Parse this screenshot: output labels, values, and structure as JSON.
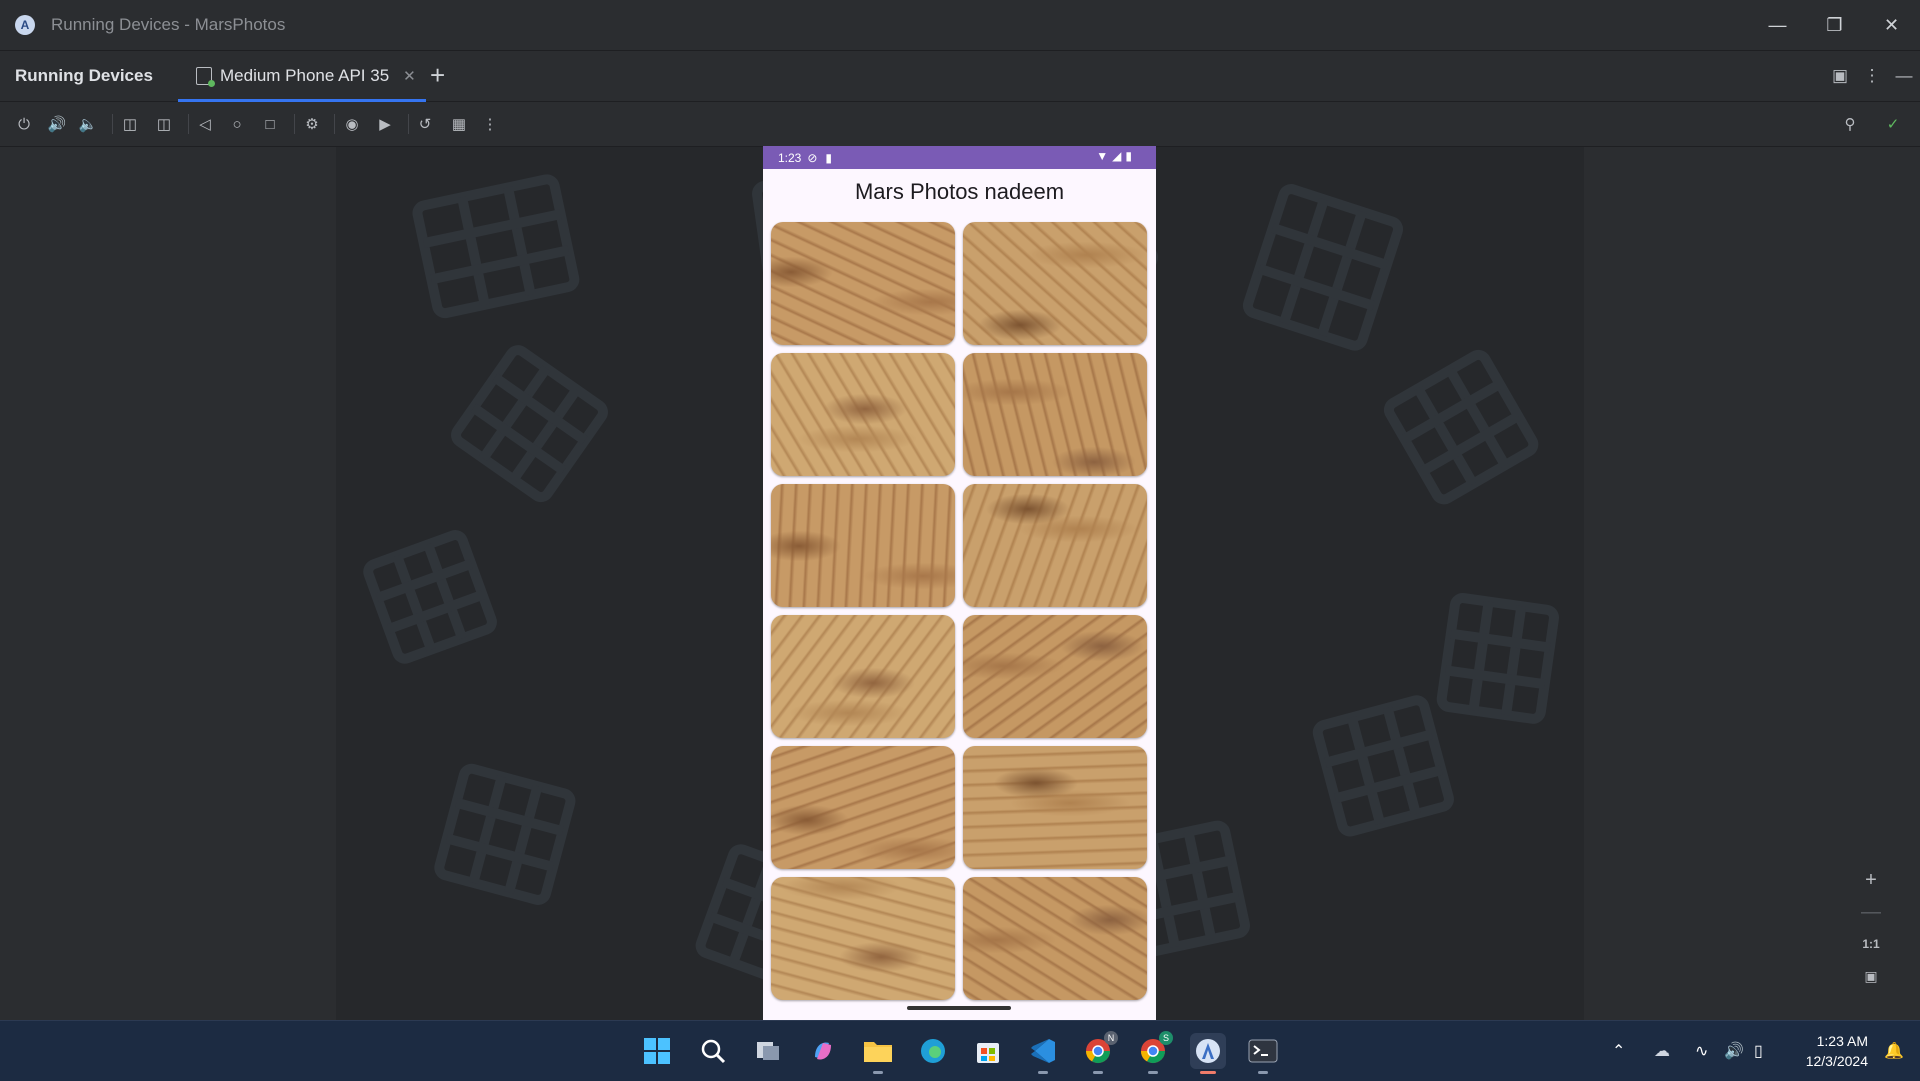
{
  "window": {
    "title": "Running Devices - MarsPhotos",
    "controls": [
      "minimize",
      "restore",
      "close"
    ]
  },
  "tool_window": {
    "title": "Running Devices",
    "tab_label": "Medium Phone API 35"
  },
  "toolbar_icons": [
    "power-icon",
    "volume-up-icon",
    "volume-down-icon",
    "rotate-left-icon",
    "rotate-right-icon",
    "back-icon",
    "home-icon",
    "overview-icon",
    "device-settings-icon",
    "screenshot-icon",
    "screen-record-icon",
    "reset-icon",
    "layout-inspector-icon",
    "more-icon",
    "find-in-device-icon",
    "check-icon"
  ],
  "device": {
    "status": {
      "time": "1:23"
    },
    "app_title": "Mars Photos nadeem",
    "photo_count": 12
  },
  "zoom": {
    "one_to_one": "1:1"
  },
  "taskbar": {
    "time": "1:23 AM",
    "date": "12/3/2024",
    "badges": {
      "chrome_n": "N",
      "chrome_s": "S"
    }
  },
  "colors": {
    "accent": "#3574f0",
    "status_bar": "#7a5bb5",
    "ide_bg": "#2b2d30",
    "taskbar": "#1c2b42"
  }
}
